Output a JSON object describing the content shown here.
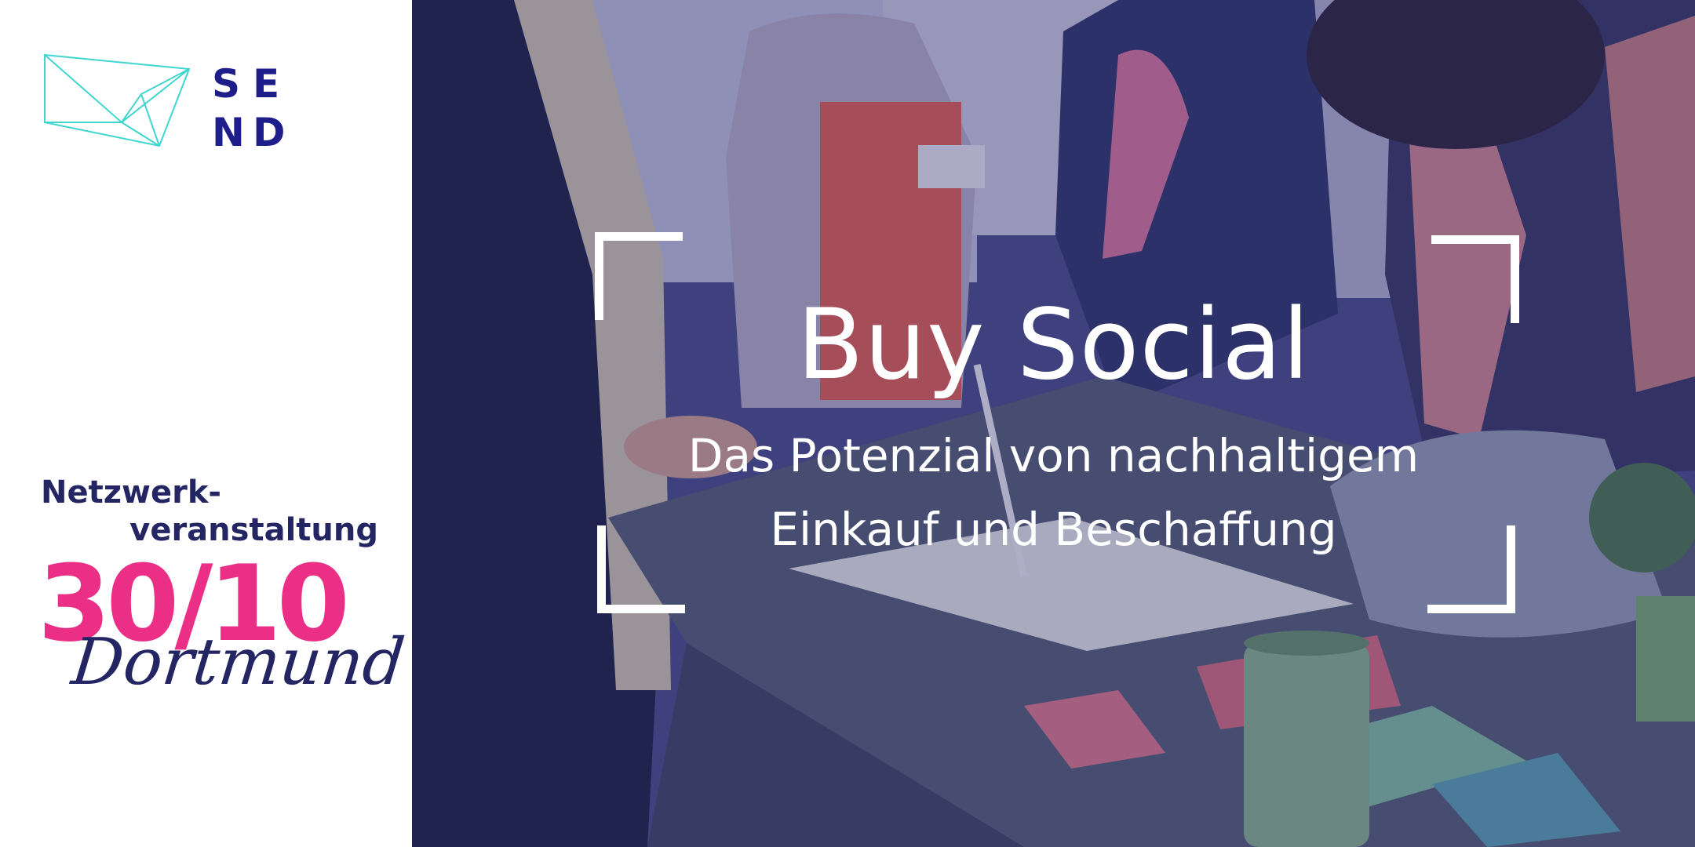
{
  "logo": {
    "icon": "send-logo-icon",
    "letters": [
      "S",
      "E",
      "N",
      "D"
    ]
  },
  "event": {
    "type_line1": "Netzwerk-",
    "type_line2": "veranstaltung",
    "date": "30/10",
    "city": "Dortmund"
  },
  "hero": {
    "title": "Buy Social",
    "subtitle_line1": "Das Potenzial von nachhaltigem",
    "subtitle_line2": "Einkauf und Beschaffung"
  },
  "colors": {
    "brand_navy": "#1d1e8c",
    "text_navy": "#242563",
    "accent_pink": "#ec2f86",
    "logo_teal": "#3fd6d0",
    "overlay": "#282a6e"
  }
}
